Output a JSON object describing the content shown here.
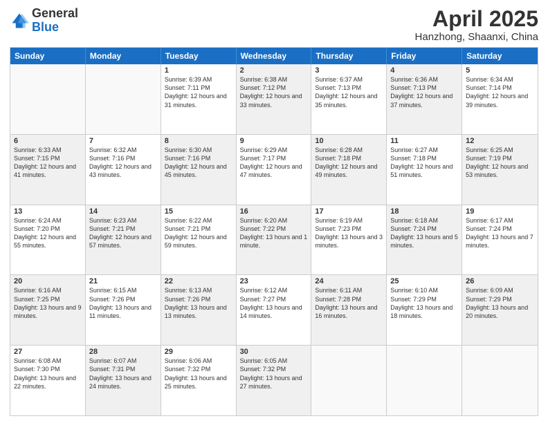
{
  "header": {
    "logo_general": "General",
    "logo_blue": "Blue",
    "title": "April 2025",
    "location": "Hanzhong, Shaanxi, China"
  },
  "days_of_week": [
    "Sunday",
    "Monday",
    "Tuesday",
    "Wednesday",
    "Thursday",
    "Friday",
    "Saturday"
  ],
  "weeks": [
    [
      {
        "day": "",
        "info": "",
        "shaded": false,
        "empty": true
      },
      {
        "day": "",
        "info": "",
        "shaded": false,
        "empty": true
      },
      {
        "day": "1",
        "info": "Sunrise: 6:39 AM\nSunset: 7:11 PM\nDaylight: 12 hours and 31 minutes.",
        "shaded": false
      },
      {
        "day": "2",
        "info": "Sunrise: 6:38 AM\nSunset: 7:12 PM\nDaylight: 12 hours and 33 minutes.",
        "shaded": true
      },
      {
        "day": "3",
        "info": "Sunrise: 6:37 AM\nSunset: 7:13 PM\nDaylight: 12 hours and 35 minutes.",
        "shaded": false
      },
      {
        "day": "4",
        "info": "Sunrise: 6:36 AM\nSunset: 7:13 PM\nDaylight: 12 hours and 37 minutes.",
        "shaded": true
      },
      {
        "day": "5",
        "info": "Sunrise: 6:34 AM\nSunset: 7:14 PM\nDaylight: 12 hours and 39 minutes.",
        "shaded": false
      }
    ],
    [
      {
        "day": "6",
        "info": "Sunrise: 6:33 AM\nSunset: 7:15 PM\nDaylight: 12 hours and 41 minutes.",
        "shaded": true
      },
      {
        "day": "7",
        "info": "Sunrise: 6:32 AM\nSunset: 7:16 PM\nDaylight: 12 hours and 43 minutes.",
        "shaded": false
      },
      {
        "day": "8",
        "info": "Sunrise: 6:30 AM\nSunset: 7:16 PM\nDaylight: 12 hours and 45 minutes.",
        "shaded": true
      },
      {
        "day": "9",
        "info": "Sunrise: 6:29 AM\nSunset: 7:17 PM\nDaylight: 12 hours and 47 minutes.",
        "shaded": false
      },
      {
        "day": "10",
        "info": "Sunrise: 6:28 AM\nSunset: 7:18 PM\nDaylight: 12 hours and 49 minutes.",
        "shaded": true
      },
      {
        "day": "11",
        "info": "Sunrise: 6:27 AM\nSunset: 7:18 PM\nDaylight: 12 hours and 51 minutes.",
        "shaded": false
      },
      {
        "day": "12",
        "info": "Sunrise: 6:25 AM\nSunset: 7:19 PM\nDaylight: 12 hours and 53 minutes.",
        "shaded": true
      }
    ],
    [
      {
        "day": "13",
        "info": "Sunrise: 6:24 AM\nSunset: 7:20 PM\nDaylight: 12 hours and 55 minutes.",
        "shaded": false
      },
      {
        "day": "14",
        "info": "Sunrise: 6:23 AM\nSunset: 7:21 PM\nDaylight: 12 hours and 57 minutes.",
        "shaded": true
      },
      {
        "day": "15",
        "info": "Sunrise: 6:22 AM\nSunset: 7:21 PM\nDaylight: 12 hours and 59 minutes.",
        "shaded": false
      },
      {
        "day": "16",
        "info": "Sunrise: 6:20 AM\nSunset: 7:22 PM\nDaylight: 13 hours and 1 minute.",
        "shaded": true
      },
      {
        "day": "17",
        "info": "Sunrise: 6:19 AM\nSunset: 7:23 PM\nDaylight: 13 hours and 3 minutes.",
        "shaded": false
      },
      {
        "day": "18",
        "info": "Sunrise: 6:18 AM\nSunset: 7:24 PM\nDaylight: 13 hours and 5 minutes.",
        "shaded": true
      },
      {
        "day": "19",
        "info": "Sunrise: 6:17 AM\nSunset: 7:24 PM\nDaylight: 13 hours and 7 minutes.",
        "shaded": false
      }
    ],
    [
      {
        "day": "20",
        "info": "Sunrise: 6:16 AM\nSunset: 7:25 PM\nDaylight: 13 hours and 9 minutes.",
        "shaded": true
      },
      {
        "day": "21",
        "info": "Sunrise: 6:15 AM\nSunset: 7:26 PM\nDaylight: 13 hours and 11 minutes.",
        "shaded": false
      },
      {
        "day": "22",
        "info": "Sunrise: 6:13 AM\nSunset: 7:26 PM\nDaylight: 13 hours and 13 minutes.",
        "shaded": true
      },
      {
        "day": "23",
        "info": "Sunrise: 6:12 AM\nSunset: 7:27 PM\nDaylight: 13 hours and 14 minutes.",
        "shaded": false
      },
      {
        "day": "24",
        "info": "Sunrise: 6:11 AM\nSunset: 7:28 PM\nDaylight: 13 hours and 16 minutes.",
        "shaded": true
      },
      {
        "day": "25",
        "info": "Sunrise: 6:10 AM\nSunset: 7:29 PM\nDaylight: 13 hours and 18 minutes.",
        "shaded": false
      },
      {
        "day": "26",
        "info": "Sunrise: 6:09 AM\nSunset: 7:29 PM\nDaylight: 13 hours and 20 minutes.",
        "shaded": true
      }
    ],
    [
      {
        "day": "27",
        "info": "Sunrise: 6:08 AM\nSunset: 7:30 PM\nDaylight: 13 hours and 22 minutes.",
        "shaded": false
      },
      {
        "day": "28",
        "info": "Sunrise: 6:07 AM\nSunset: 7:31 PM\nDaylight: 13 hours and 24 minutes.",
        "shaded": true
      },
      {
        "day": "29",
        "info": "Sunrise: 6:06 AM\nSunset: 7:32 PM\nDaylight: 13 hours and 25 minutes.",
        "shaded": false
      },
      {
        "day": "30",
        "info": "Sunrise: 6:05 AM\nSunset: 7:32 PM\nDaylight: 13 hours and 27 minutes.",
        "shaded": true
      },
      {
        "day": "",
        "info": "",
        "shaded": false,
        "empty": true
      },
      {
        "day": "",
        "info": "",
        "shaded": false,
        "empty": true
      },
      {
        "day": "",
        "info": "",
        "shaded": false,
        "empty": true
      }
    ]
  ]
}
